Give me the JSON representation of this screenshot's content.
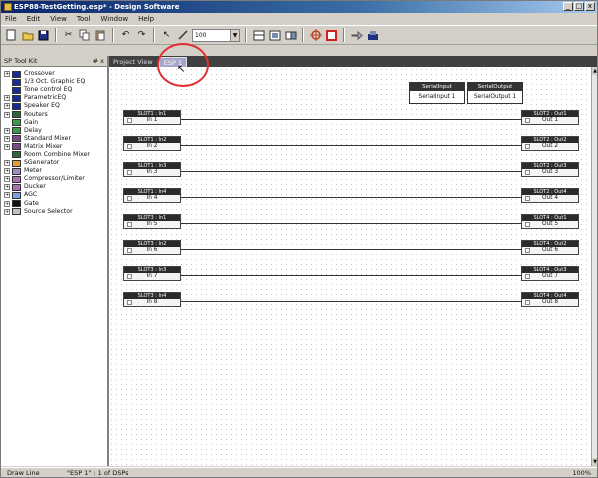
{
  "window": {
    "title": "ESP88-TestGetting.esp* - Design Software",
    "controls": [
      "_",
      "□",
      "x"
    ]
  },
  "menu": [
    "File",
    "Edit",
    "View",
    "Tool",
    "Window",
    "Help"
  ],
  "toolbar": {
    "zoom_value": "100",
    "buttons": [
      "new-file-icon",
      "open-folder-icon",
      "save-icon",
      "cut-icon",
      "copy-icon",
      "paste-icon",
      "undo-icon",
      "redo-icon",
      "pointer-tool-icon",
      "wire-tool-icon",
      "grid-icon",
      "block-view-icon",
      "link-icon",
      "compile-icon",
      "stop-icon",
      "send-icon",
      "download-icon"
    ]
  },
  "left_pane": {
    "title": "SP Tool Kit",
    "close_label": "# x",
    "items": [
      {
        "label": "Crossover",
        "color": "#1a2a9a",
        "expandable": true
      },
      {
        "label": "1/3 Oct. Graphic EQ",
        "color": "#1a2a9a",
        "expandable": false
      },
      {
        "label": "Tone control EQ",
        "color": "#1a2a9a",
        "expandable": false
      },
      {
        "label": "ParametricEQ",
        "color": "#1a2a9a",
        "expandable": true
      },
      {
        "label": "Speaker EQ",
        "color": "#1a2a9a",
        "expandable": true
      },
      {
        "label": "Routers",
        "color": "#2a6a3a",
        "expandable": true
      },
      {
        "label": "Gain",
        "color": "#3a9a4a",
        "expandable": false
      },
      {
        "label": "Delay",
        "color": "#3a9a4a",
        "expandable": true
      },
      {
        "label": "Standard Mixer",
        "color": "#7a4a8a",
        "expandable": true
      },
      {
        "label": "Matrix Mixer",
        "color": "#7a4a8a",
        "expandable": true
      },
      {
        "label": "Room Combine Mixer",
        "color": "#2a6a3a",
        "expandable": false
      },
      {
        "label": "SGenerator",
        "color": "#e0a030",
        "expandable": true
      },
      {
        "label": "Meter",
        "color": "#a08ac8",
        "expandable": true
      },
      {
        "label": "Compressor/Limiter",
        "color": "#b070b0",
        "expandable": true
      },
      {
        "label": "Ducker",
        "color": "#b070b0",
        "expandable": true
      },
      {
        "label": "AGC",
        "color": "#7aa0e0",
        "expandable": true
      },
      {
        "label": "Gate",
        "color": "#111111",
        "expandable": true
      },
      {
        "label": "Source Selector",
        "color": "#c0c0c0",
        "expandable": true
      }
    ]
  },
  "tabs": [
    {
      "label": "Project View",
      "active": false
    },
    {
      "label": "ESP 1",
      "active": true
    }
  ],
  "serial": {
    "input_header": "SerialInput",
    "input_label": "SerialInput 1",
    "output_header": "SerialOutput",
    "output_label": "SerialOutput 1"
  },
  "inputs": [
    {
      "header": "SLOT1 : In1",
      "label": "In 1"
    },
    {
      "header": "SLOT1 : In2",
      "label": "In 2"
    },
    {
      "header": "SLOT1 : In3",
      "label": "In 3"
    },
    {
      "header": "SLOT1 : In4",
      "label": "In 4"
    },
    {
      "header": "SLOT3 : In1",
      "label": "In 5"
    },
    {
      "header": "SLOT3 : In2",
      "label": "In 6"
    },
    {
      "header": "SLOT3 : In3",
      "label": "In 7"
    },
    {
      "header": "SLOT3 : In4",
      "label": "In 8"
    }
  ],
  "outputs": [
    {
      "header": "SLOT2 : Out1",
      "label": "Out 1"
    },
    {
      "header": "SLOT2 : Out2",
      "label": "Out 2"
    },
    {
      "header": "SLOT2 : Out3",
      "label": "Out 3"
    },
    {
      "header": "SLOT2 : Out4",
      "label": "Out 4"
    },
    {
      "header": "SLOT4 : Out1",
      "label": "Out 5"
    },
    {
      "header": "SLOT4 : Out2",
      "label": "Out 6"
    },
    {
      "header": "SLOT4 : Out3",
      "label": "Out 7"
    },
    {
      "header": "SLOT4 : Out4",
      "label": "Out 8"
    }
  ],
  "status": {
    "mode": "Draw Line",
    "dsp_info": "\"ESP 1\" : 1 of DSPs",
    "zoom": "100%"
  },
  "colors": {
    "annotation": "#e03030",
    "title_start": "#0a246a"
  }
}
